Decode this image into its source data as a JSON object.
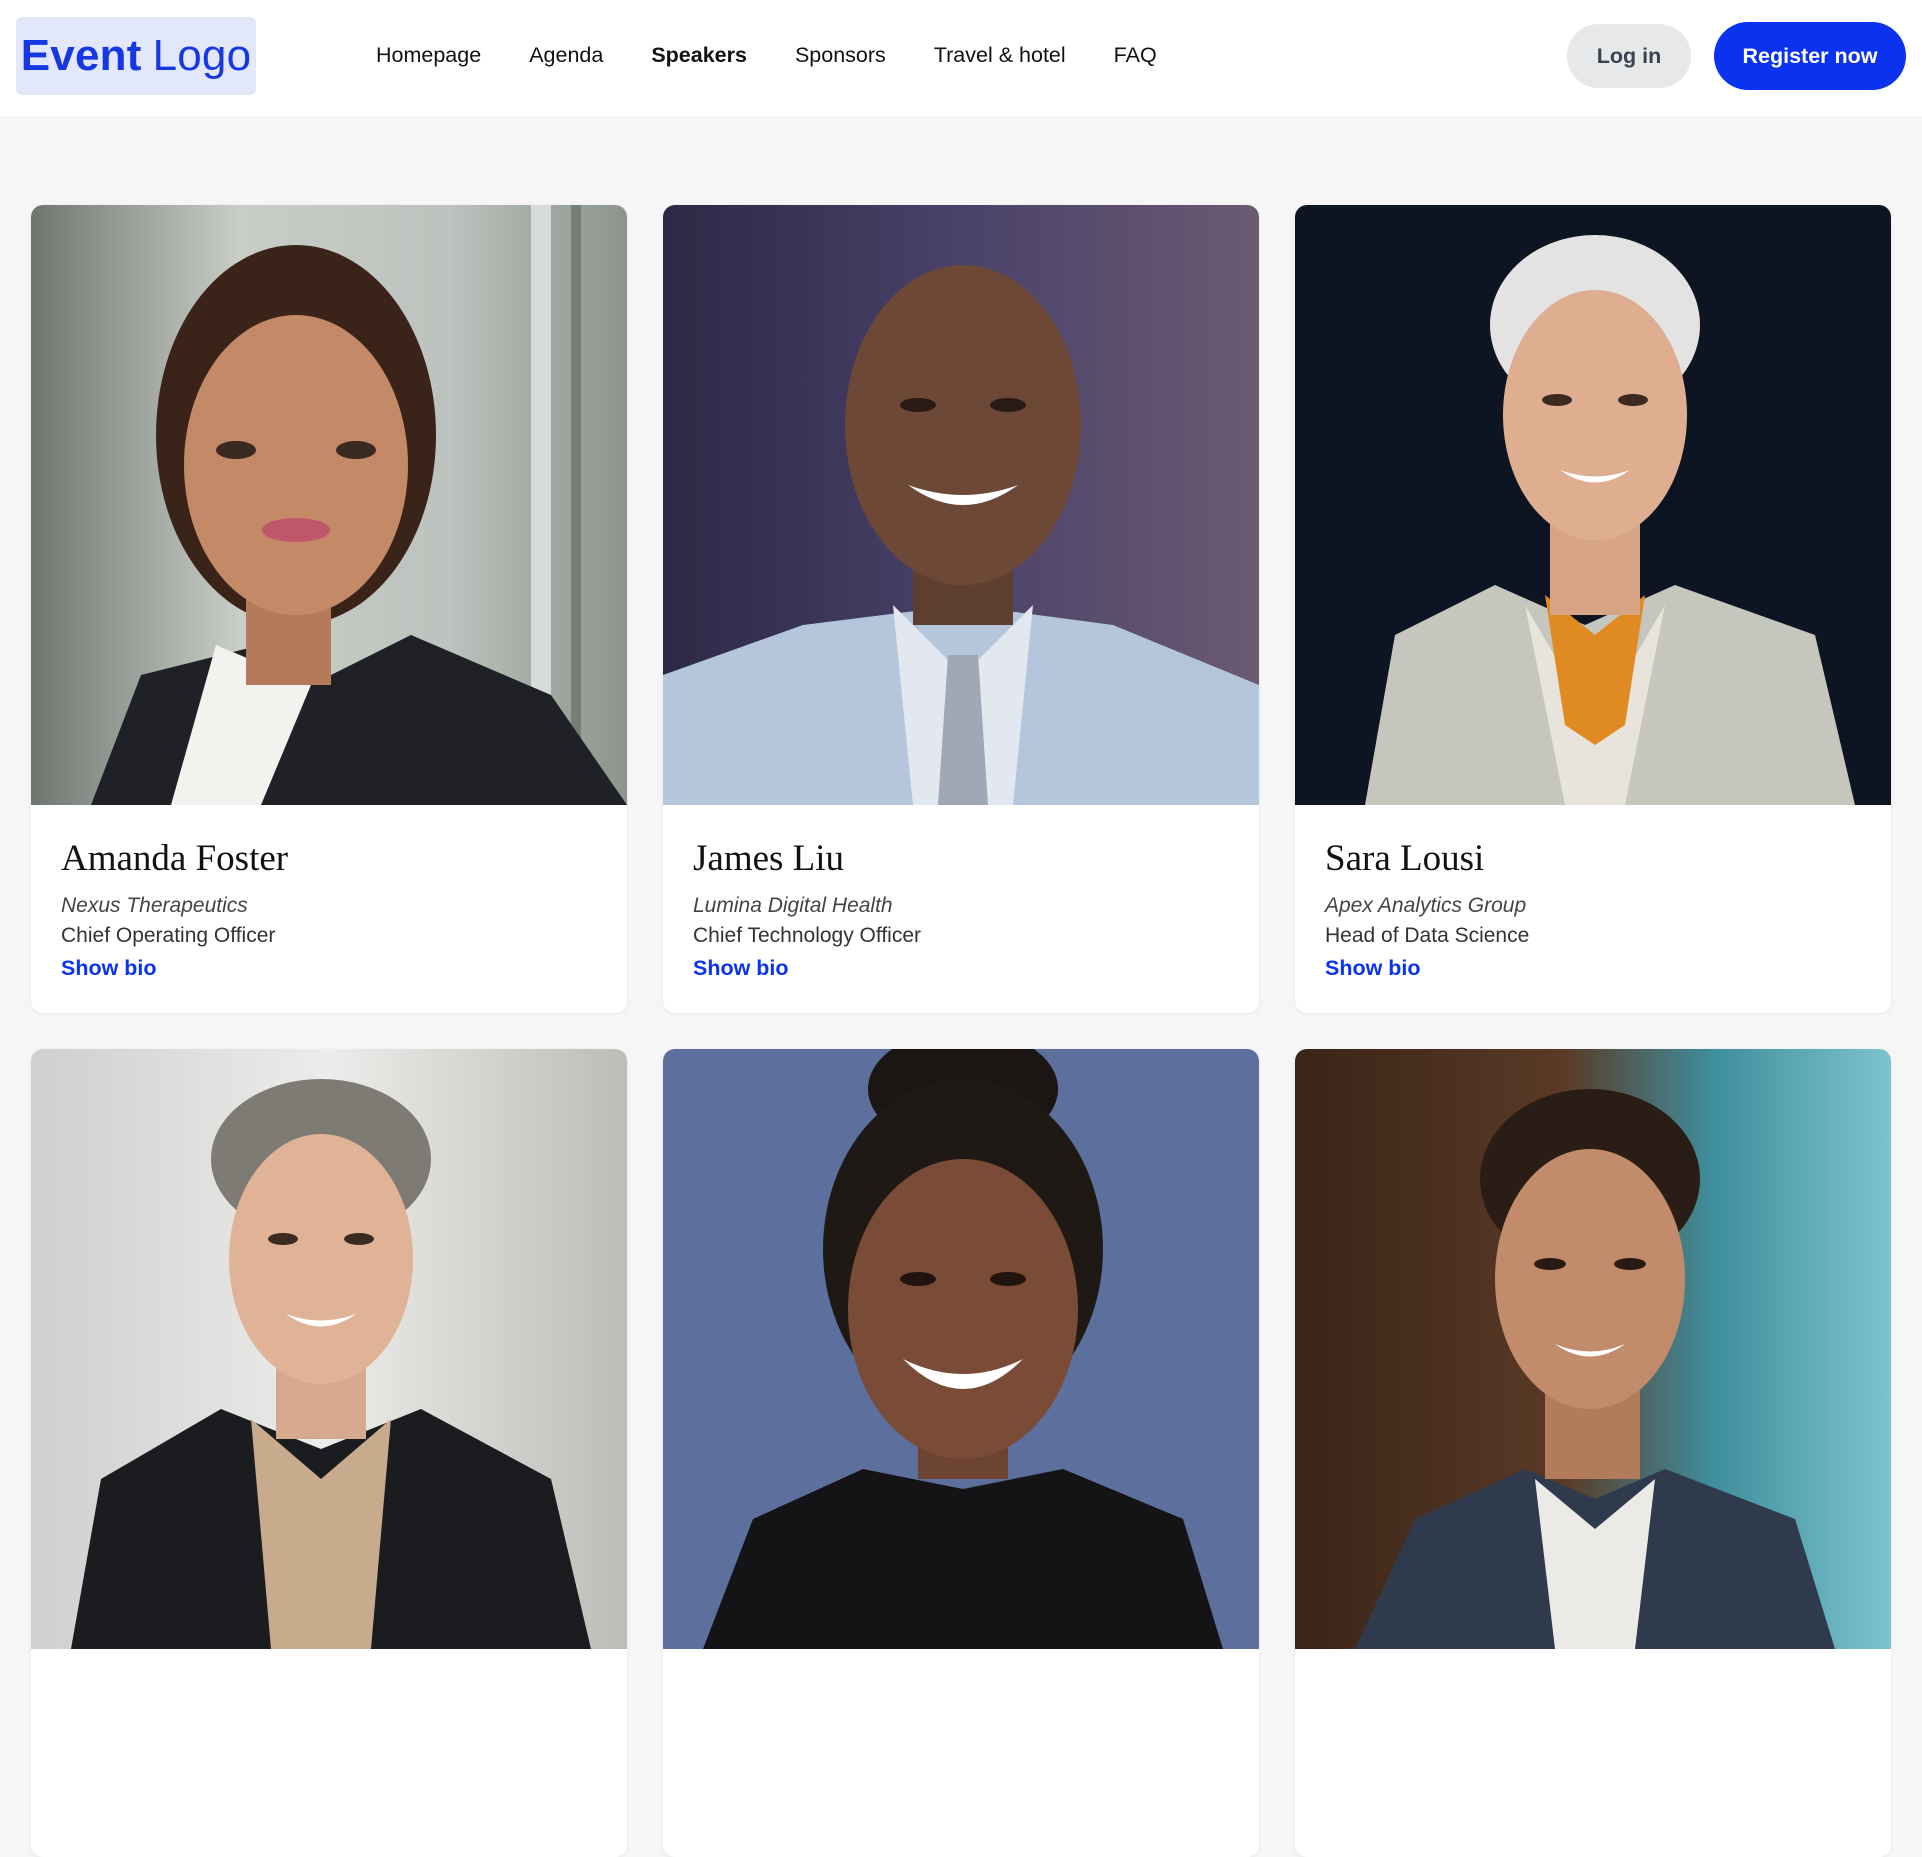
{
  "header": {
    "logo_bold": "Event",
    "logo_light": "Logo",
    "nav": [
      {
        "label": "Homepage",
        "active": false
      },
      {
        "label": "Agenda",
        "active": false
      },
      {
        "label": "Speakers",
        "active": true
      },
      {
        "label": "Sponsors",
        "active": false
      },
      {
        "label": "Travel & hotel",
        "active": false
      },
      {
        "label": "FAQ",
        "active": false
      }
    ],
    "login_label": "Log in",
    "register_label": "Register now"
  },
  "colors": {
    "accent": "#0b32ee",
    "logo_bg": "#e3e7fc",
    "page_bg": "#f6f6f6"
  },
  "speakers": [
    {
      "name": "Amanda Foster",
      "company": "Nexus Therapeutics",
      "role": "Chief Operating Officer",
      "link": "Show bio",
      "photo": "woman-portrait-office"
    },
    {
      "name": "James Liu",
      "company": "Lumina Digital Health",
      "role": "Chief Technology Officer",
      "link": "Show bio",
      "photo": "man-portrait-purple-bg"
    },
    {
      "name": "Sara Lousi",
      "company": "Apex Analytics Group",
      "role": "Head of Data Science",
      "link": "Show bio",
      "photo": "woman-portrait-dark-bg"
    },
    {
      "name": "",
      "company": "",
      "role": "",
      "link": "",
      "photo": "woman-portrait-light-bg"
    },
    {
      "name": "",
      "company": "",
      "role": "",
      "link": "",
      "photo": "woman-portrait-blue-bg"
    },
    {
      "name": "",
      "company": "",
      "role": "",
      "link": "",
      "photo": "man-speaker-stage"
    }
  ]
}
